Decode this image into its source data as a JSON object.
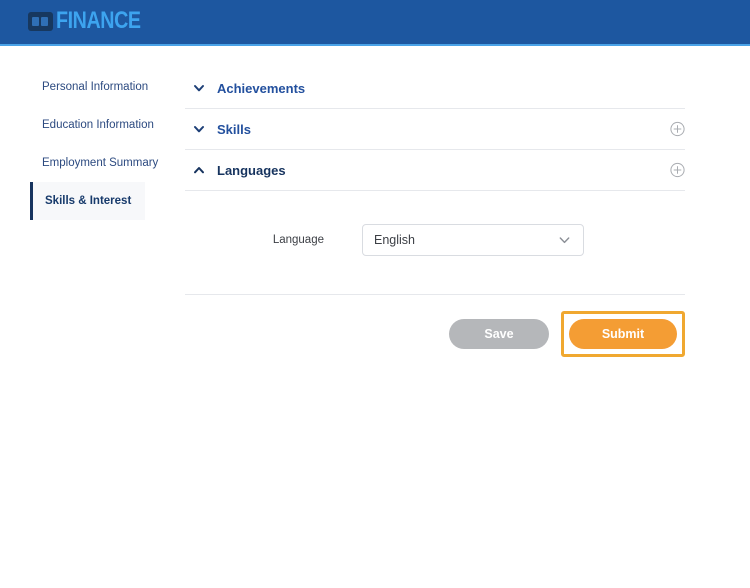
{
  "header": {
    "brand_text": "FINANCE",
    "brand_icon": "card-logo-icon",
    "bg_color": "#1d57a0",
    "accent_color": "#3da4ef"
  },
  "sidebar": {
    "items": [
      {
        "label": "Personal Information",
        "active": false
      },
      {
        "label": "Education Information",
        "active": false
      },
      {
        "label": "Employment Summary",
        "active": false
      },
      {
        "label": "Skills & Interest",
        "active": true
      }
    ]
  },
  "main": {
    "sections": [
      {
        "title": "Achievements",
        "chevron": "chevron-down-icon",
        "expanded": false,
        "has_add": false
      },
      {
        "title": "Skills",
        "chevron": "chevron-down-icon",
        "expanded": false,
        "has_add": true
      },
      {
        "title": "Languages",
        "chevron": "chevron-up-icon",
        "expanded": true,
        "has_add": true
      }
    ],
    "form": {
      "language_label": "Language",
      "language_value": "English",
      "language_options": [
        "English"
      ],
      "dropdown_icon": "chevron-down-icon"
    },
    "actions": {
      "save_label": "Save",
      "submit_label": "Submit",
      "save_color": "#b5b7ba",
      "submit_color": "#f49d34",
      "focus_color": "#f0a830"
    }
  }
}
